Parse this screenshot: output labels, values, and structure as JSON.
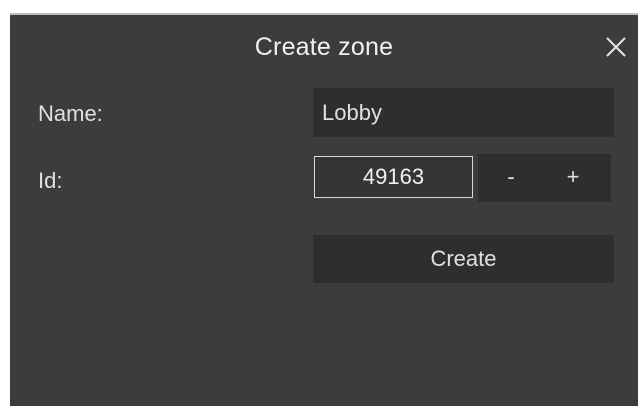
{
  "dialog": {
    "title": "Create zone",
    "close_icon": "close-icon"
  },
  "form": {
    "name_label": "Name:",
    "name_value": "Lobby",
    "id_label": "Id:",
    "id_value": "49163",
    "decrement_label": "-",
    "increment_label": "+",
    "create_label": "Create"
  },
  "colors": {
    "background": "#3c3c3c",
    "field_background": "#2e2e2e",
    "text": "#e0e0e0",
    "field_border": "#d8d8d8"
  }
}
